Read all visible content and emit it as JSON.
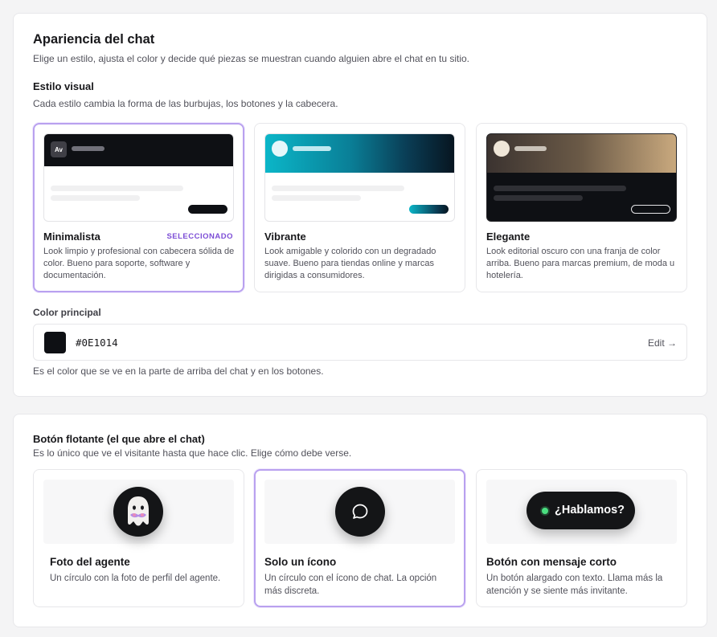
{
  "appearance": {
    "title": "Apariencia del chat",
    "subtitle": "Elige un estilo, ajusta el color y decide qué piezas se muestran cuando alguien abre el chat en tu sitio.",
    "visual_style": {
      "heading": "Estilo visual",
      "description": "Cada estilo cambia la forma de las burbujas, los botones y la cabecera.",
      "options": [
        {
          "title": "Minimalista",
          "badge": "SELECCIONADO",
          "avatar_initials": "Av",
          "description": "Look limpio y profesional con cabecera sólida de color. Bueno para soporte, software y documentación."
        },
        {
          "title": "Vibrante",
          "description": "Look amigable y colorido con un degradado suave. Bueno para tiendas online y marcas dirigidas a consumidores."
        },
        {
          "title": "Elegante",
          "description": "Look editorial oscuro con una franja de color arriba. Bueno para marcas premium, de moda u hotelería."
        }
      ]
    },
    "primary_color": {
      "label": "Color principal",
      "value": "#0E1014",
      "edit_label": "Edit →",
      "help": "Es el color que se ve en la parte de arriba del chat y en los botones."
    }
  },
  "launcher": {
    "title": "Botón flotante (el que abre el chat)",
    "subtitle": "Es lo único que ve el visitante hasta que hace clic. Elige cómo debe verse.",
    "options": [
      {
        "title": "Foto del agente",
        "description": "Un círculo con la foto de perfil del agente."
      },
      {
        "title": "Solo un ícono",
        "description": "Un círculo con el ícono de chat. La opción más discreta."
      },
      {
        "title": "Botón con mensaje corto",
        "description": "Un botón alargado con texto. Llama más la atención y se siente más invitante.",
        "pill_text": "¿Hablamos?"
      }
    ]
  },
  "colors": {
    "accent": "#b9a1ef",
    "badge": "#7c4dd6",
    "primary": "#0e1014",
    "online": "#4ade80"
  },
  "icons": {
    "agent_avatar": "ghost-avatar-icon",
    "chat": "chat-bubble-icon",
    "status": "online-dot-icon"
  }
}
